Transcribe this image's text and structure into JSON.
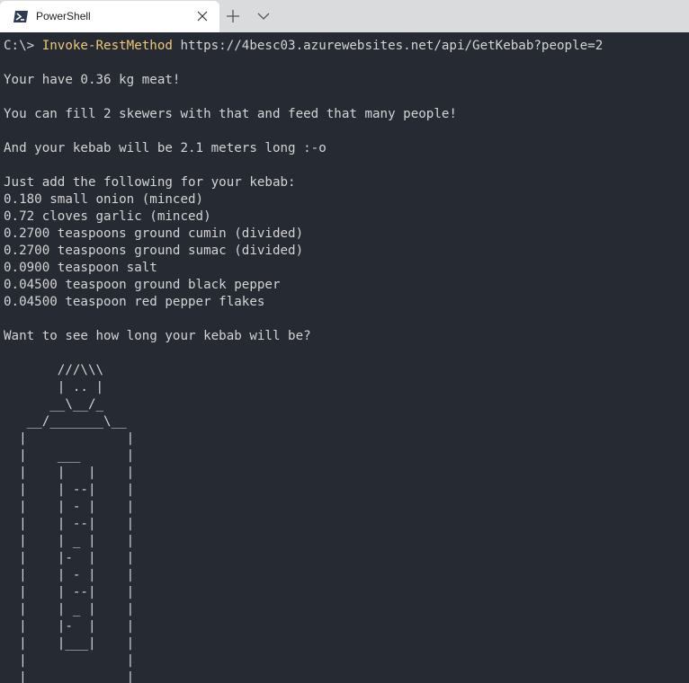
{
  "window": {
    "tab_title": "PowerShell",
    "tab_icon": "powershell-icon",
    "close_icon": "close-icon",
    "new_tab_icon": "plus-icon",
    "dropdown_icon": "chevron-down-icon"
  },
  "terminal": {
    "prompt": "C:\\> ",
    "command": "Invoke-RestMethod",
    "argument": " https://4besc03.azurewebsites.net/api/GetKebab?people=2",
    "output": "\nYour have 0.36 kg meat!\n\nYou can fill 2 skewers with that and feed that many people!\n\nAnd your kebab will be 2.1 meters long :-o\n\nJust add the following for your kebab:\n0.180 small onion (minced)\n0.72 cloves garlic (minced)\n0.2700 teaspoons ground cumin (divided)\n0.2700 teaspoons ground sumac (divided)\n0.0900 teaspoon salt\n0.04500 teaspoon ground black pepper\n0.04500 teaspoon red pepper flakes\n\nWant to see how long your kebab will be?\n\n       ///\\\\\\\n       | .. |\n      __\\__/_\n   __/_______\\__\n  |             |\n  |    ___      |\n  |    |   |    |\n  |    | --|    |\n  |    | - |    |\n  |    | --|    |\n  |    | _ |    |\n  |    |-  |    |\n  |    | - |    |\n  |    | --|    |\n  |    | _ |    |\n  |    |-  |    |\n  |    |___|    |\n  |             |\n  |_____________|"
  },
  "colors": {
    "background": "#262a33",
    "text": "#d4d4d4",
    "command": "#f0c674",
    "tabbar": "#dadbdc"
  }
}
